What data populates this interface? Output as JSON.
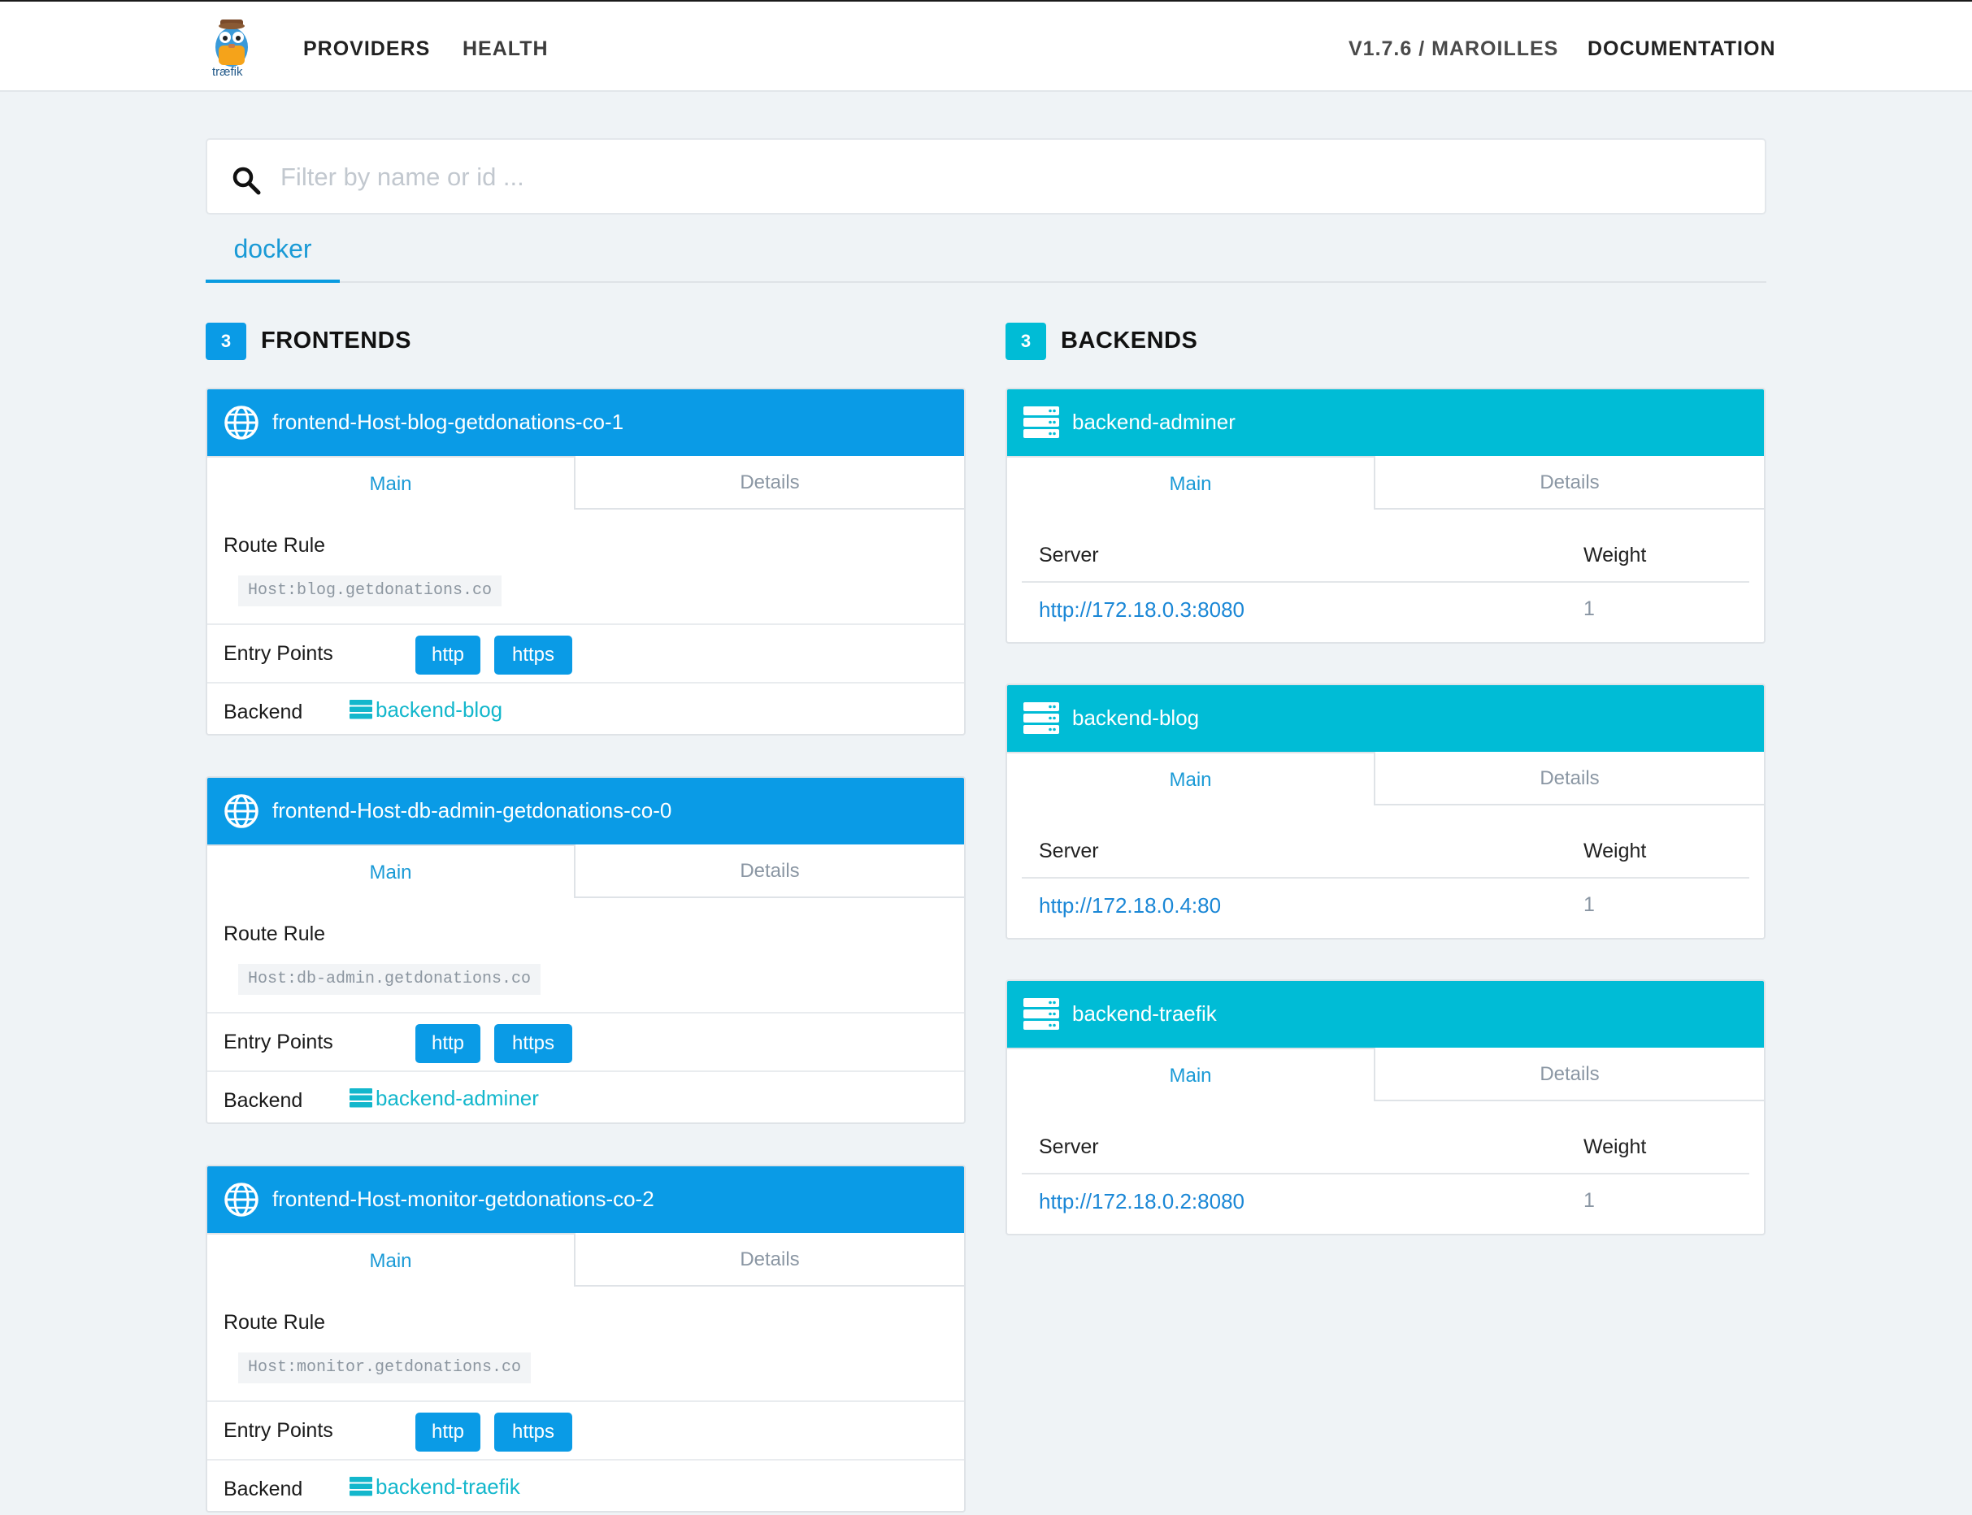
{
  "nav": {
    "logo_text": "træfik",
    "links": [
      "PROVIDERS",
      "HEALTH"
    ],
    "version": "V1.7.6 / MAROILLES",
    "documentation": "DOCUMENTATION"
  },
  "search": {
    "placeholder": "Filter by name or id ...",
    "value": ""
  },
  "provider_tab": "docker",
  "frontends": {
    "count": "3",
    "title": "FRONTENDS",
    "items": [
      {
        "name": "frontend-Host-blog-getdonations-co-1",
        "tab_main": "Main",
        "tab_details": "Details",
        "route_rule_label": "Route Rule",
        "route_rule": "Host:blog.getdonations.co",
        "entry_points_label": "Entry Points",
        "entry_points": [
          "http",
          "https"
        ],
        "backend_label": "Backend",
        "backend": "backend-blog"
      },
      {
        "name": "frontend-Host-db-admin-getdonations-co-0",
        "tab_main": "Main",
        "tab_details": "Details",
        "route_rule_label": "Route Rule",
        "route_rule": "Host:db-admin.getdonations.co",
        "entry_points_label": "Entry Points",
        "entry_points": [
          "http",
          "https"
        ],
        "backend_label": "Backend",
        "backend": "backend-adminer"
      },
      {
        "name": "frontend-Host-monitor-getdonations-co-2",
        "tab_main": "Main",
        "tab_details": "Details",
        "route_rule_label": "Route Rule",
        "route_rule": "Host:monitor.getdonations.co",
        "entry_points_label": "Entry Points",
        "entry_points": [
          "http",
          "https"
        ],
        "backend_label": "Backend",
        "backend": "backend-traefik"
      }
    ]
  },
  "backends": {
    "count": "3",
    "title": "BACKENDS",
    "items": [
      {
        "name": "backend-adminer",
        "tab_main": "Main",
        "tab_details": "Details",
        "server_header": "Server",
        "weight_header": "Weight",
        "server": "http://172.18.0.3:8080",
        "weight": "1"
      },
      {
        "name": "backend-blog",
        "tab_main": "Main",
        "tab_details": "Details",
        "server_header": "Server",
        "weight_header": "Weight",
        "server": "http://172.18.0.4:80",
        "weight": "1"
      },
      {
        "name": "backend-traefik",
        "tab_main": "Main",
        "tab_details": "Details",
        "server_header": "Server",
        "weight_header": "Weight",
        "server": "http://172.18.0.2:8080",
        "weight": "1"
      }
    ]
  },
  "colors": {
    "frontend_accent": "#0a9be6",
    "backend_accent": "#00bcd6",
    "link": "#1a87d6",
    "page_bg": "#eff3f6"
  }
}
